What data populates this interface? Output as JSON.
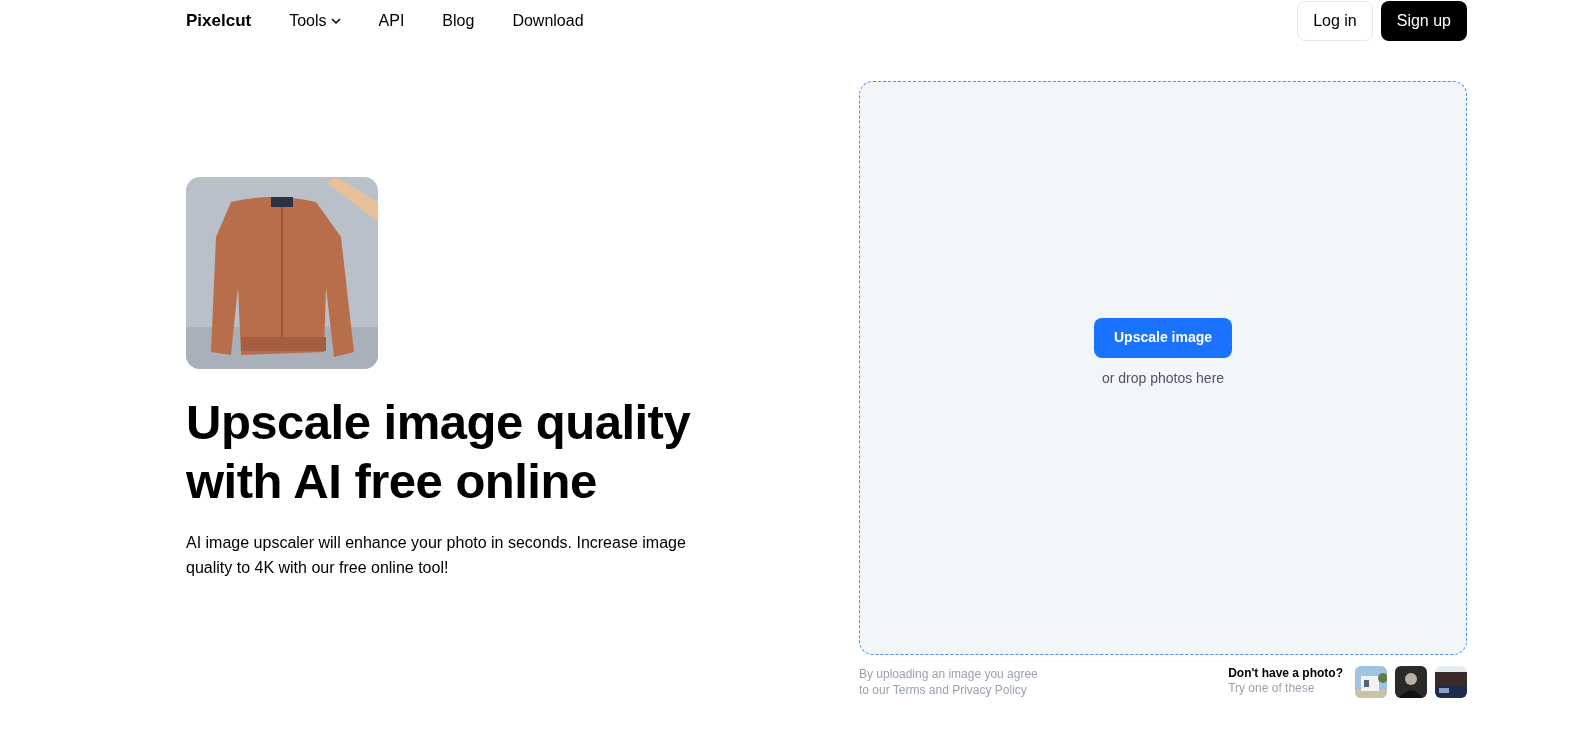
{
  "header": {
    "logo": "Pixelcut",
    "nav": [
      {
        "label": "Tools",
        "kind": "dropdown"
      },
      {
        "label": "API",
        "kind": "link"
      },
      {
        "label": "Blog",
        "kind": "link"
      },
      {
        "label": "Download",
        "kind": "link"
      }
    ],
    "login": "Log in",
    "signup": "Sign up"
  },
  "hero": {
    "title": "Upscale image quality with AI free online",
    "subtitle": "AI image upscaler will enhance your photo in seconds. Increase image quality to 4K with our free online tool!"
  },
  "upload": {
    "button": "Upscale image",
    "hint": "or drop photos here",
    "terms_line_1": "By uploading an image you agree",
    "terms_line_2": "to our Terms and Privacy Policy",
    "samples_title": "Don't have a photo?",
    "samples_hint": "Try one of these",
    "samples": [
      {
        "kind": "house"
      },
      {
        "kind": "portrait"
      },
      {
        "kind": "street"
      }
    ]
  }
}
